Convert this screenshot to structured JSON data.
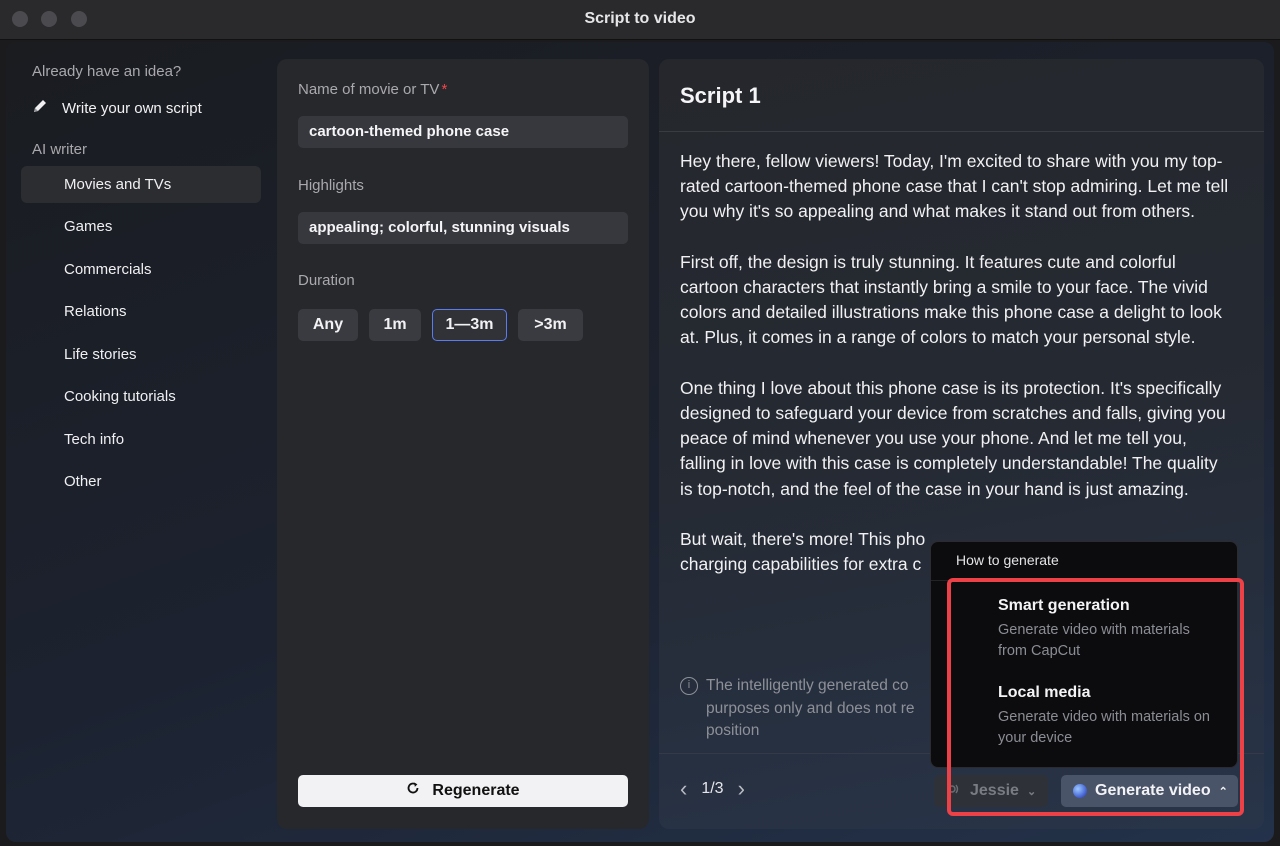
{
  "window": {
    "title": "Script to video"
  },
  "sidebar": {
    "idea_heading": "Already have an idea?",
    "write_label": "Write your own script",
    "ai_heading": "AI writer",
    "items": [
      {
        "label": "Movies and TVs",
        "active": true
      },
      {
        "label": "Games"
      },
      {
        "label": "Commercials"
      },
      {
        "label": "Relations"
      },
      {
        "label": "Life stories"
      },
      {
        "label": "Cooking tutorials"
      },
      {
        "label": "Tech info"
      },
      {
        "label": "Other"
      }
    ]
  },
  "form": {
    "name_label": "Name of movie or TV",
    "required_mark": "*",
    "name_value": "cartoon-themed phone case",
    "highlights_label": "Highlights",
    "highlights_value": "appealing; colorful, stunning visuals",
    "duration_label": "Duration",
    "durations": [
      "Any",
      "1m",
      "1—3m",
      ">3m"
    ],
    "selected_duration": "1—3m",
    "regenerate_label": "Regenerate"
  },
  "script": {
    "title": "Script 1",
    "paragraphs": [
      "Hey there, fellow viewers! Today, I'm excited to share with you my top-rated cartoon-themed phone case that I can't stop admiring. Let me tell you why it's so appealing and what makes it stand out from others.",
      "First off, the design is truly stunning. It features cute and colorful cartoon characters that instantly bring a smile to your face. The vivid colors and detailed illustrations make this phone case a delight to look at. Plus, it comes in a range of colors to match your personal style.",
      "One thing I love about this phone case is its protection. It's specifically designed to safeguard your device from scratches and falls, giving you peace of mind whenever you use your phone. And let me tell you, falling in love with this case is completely understandable! The quality is top-notch, and the feel of the case in your hand is just amazing.",
      "But wait, there's more! This pho",
      "charging capabilities for extra c"
    ],
    "disclaimer": "The intelligently generated co purposes only and does not re position",
    "page_indicator": "1/3",
    "voice_label": "Jessie",
    "generate_label": "Generate video"
  },
  "popup": {
    "title": "How to generate",
    "options": [
      {
        "title": "Smart generation",
        "desc": "Generate video with materials from CapCut"
      },
      {
        "title": "Local media",
        "desc": "Generate video with materials on your device"
      }
    ]
  },
  "colors": {
    "highlight": "#ec4146",
    "selected_border": "#5a7cf0",
    "required": "#f2464b"
  },
  "icons": [
    "pencil-icon",
    "refresh-icon",
    "chevron-left-icon",
    "chevron-right-icon",
    "voice-icon",
    "chevron-down-icon",
    "chevron-up-icon",
    "info-icon"
  ]
}
